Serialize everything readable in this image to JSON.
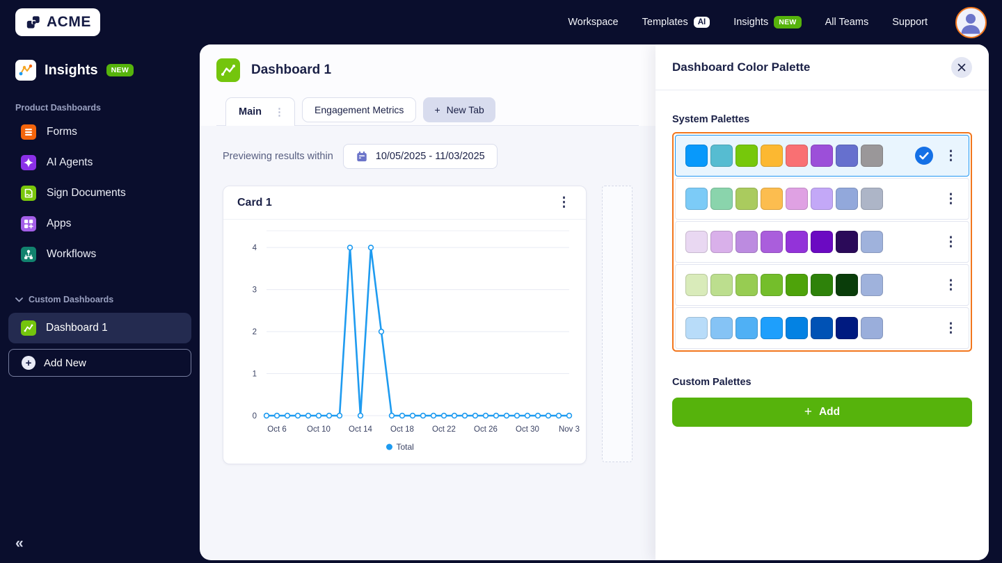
{
  "topnav": {
    "logo_text": "ACME",
    "links": [
      {
        "label": "Workspace"
      },
      {
        "label": "Templates",
        "badge": "AI"
      },
      {
        "label": "Insights",
        "badge": "NEW"
      },
      {
        "label": "All Teams"
      },
      {
        "label": "Support"
      }
    ]
  },
  "sidebar": {
    "app_title": "Insights",
    "app_badge": "NEW",
    "section_label": "Product Dashboards",
    "items": [
      {
        "label": "Forms",
        "icon": "forms-icon",
        "color": "#F4650C"
      },
      {
        "label": "AI Agents",
        "icon": "ai-agents-icon",
        "color": "#8B30E8"
      },
      {
        "label": "Sign Documents",
        "icon": "sign-documents-icon",
        "color": "#7AC70C"
      },
      {
        "label": "Apps",
        "icon": "apps-icon",
        "color": "#A45FE8"
      },
      {
        "label": "Workflows",
        "icon": "workflows-icon",
        "color": "#12826E"
      }
    ],
    "custom_section_label": "Custom Dashboards",
    "active_item": "Dashboard 1",
    "add_new_label": "Add New"
  },
  "main": {
    "title": "Dashboard 1",
    "tabs": {
      "main": "Main",
      "engagement": "Engagement Metrics",
      "new_tab": "New Tab"
    },
    "preview_label": "Previewing results within",
    "date_range": "10/05/2025 - 11/03/2025",
    "card_title": "Card 1"
  },
  "chart_data": {
    "type": "line",
    "title": "Card 1",
    "x": [
      "Oct 5",
      "Oct 6",
      "Oct 7",
      "Oct 8",
      "Oct 9",
      "Oct 10",
      "Oct 11",
      "Oct 12",
      "Oct 13",
      "Oct 14",
      "Oct 15",
      "Oct 16",
      "Oct 17",
      "Oct 18",
      "Oct 19",
      "Oct 20",
      "Oct 21",
      "Oct 22",
      "Oct 23",
      "Oct 24",
      "Oct 25",
      "Oct 26",
      "Oct 27",
      "Oct 28",
      "Oct 29",
      "Oct 30",
      "Oct 31",
      "Nov 1",
      "Nov 2",
      "Nov 3"
    ],
    "series": [
      {
        "name": "Total",
        "values": [
          0,
          0,
          0,
          0,
          0,
          0,
          0,
          0,
          4,
          0,
          4,
          2,
          0,
          0,
          0,
          0,
          0,
          0,
          0,
          0,
          0,
          0,
          0,
          0,
          0,
          0,
          0,
          0,
          0,
          0
        ]
      }
    ],
    "visible_x_ticks": [
      "Oct 6",
      "Oct 10",
      "Oct 14",
      "Oct 18",
      "Oct 22",
      "Oct 26",
      "Oct 30",
      "Nov 3"
    ],
    "y_ticks": [
      0,
      1,
      2,
      3,
      4
    ],
    "ylim": [
      0,
      4.4
    ],
    "xlabel": "",
    "ylabel": "",
    "grid": true,
    "legend_position": "bottom",
    "line_color": "#1E9BF0"
  },
  "palette_panel": {
    "title": "Dashboard Color Palette",
    "system_label": "System Palettes",
    "custom_label": "Custom Palettes",
    "add_label": "Add",
    "selected_index": 0,
    "group_border_color": "#F2761D",
    "palettes": [
      {
        "selected": true,
        "colors": [
          "#0899FB",
          "#56BCD1",
          "#76C80B",
          "#FCB831",
          "#F97073",
          "#9C4FD9",
          "#6670CE",
          "#9A9799"
        ]
      },
      {
        "selected": false,
        "colors": [
          "#7CCBF7",
          "#8AD4AC",
          "#AACB5E",
          "#FCBD4F",
          "#DFA1E3",
          "#C3A8F7",
          "#92A8DB",
          "#ADB5C7"
        ]
      },
      {
        "selected": false,
        "colors": [
          "#E9D8F2",
          "#D9B0EA",
          "#BC8BE0",
          "#AA5EDC",
          "#9333D9",
          "#6B0AC2",
          "#2B0A59",
          "#9FB2DC"
        ]
      },
      {
        "selected": false,
        "colors": [
          "#D9EBBA",
          "#BCDE8E",
          "#97CC52",
          "#74BE2B",
          "#4EA30A",
          "#2E820A",
          "#0A3D0A",
          "#9FB2DC"
        ]
      },
      {
        "selected": false,
        "colors": [
          "#B8DCF9",
          "#85C3F5",
          "#4FB0F5",
          "#1E9FFC",
          "#0382E3",
          "#0052B5",
          "#001A80",
          "#9AAEDB"
        ]
      }
    ]
  },
  "colors": {
    "navy_bg": "#0A0E2D",
    "green_accent": "#56B30C",
    "orange_accent": "#F2761D",
    "selected_row_bg": "#E9F5FE",
    "selected_row_border": "#2196F3",
    "check_circle": "#1470E6"
  }
}
